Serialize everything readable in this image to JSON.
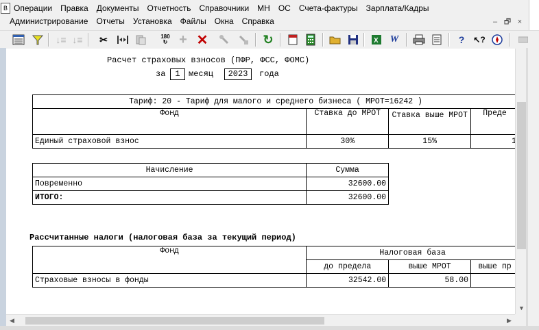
{
  "menu": {
    "row1": [
      "Операции",
      "Правка",
      "Документы",
      "Отчетность",
      "Справочники",
      "МН",
      "ОС",
      "Счета-фактуры",
      "Зарплата/Кадры"
    ],
    "row2": [
      "Администрирование",
      "Отчеты",
      "Установка",
      "Файлы",
      "Окна",
      "Справка"
    ]
  },
  "window_controls": [
    "–",
    "🗗",
    "×"
  ],
  "toolbar_icons": [
    "report-grid-icon",
    "filter-icon",
    "sort-asc-icon",
    "sort-desc-icon",
    "cut-icon",
    "split-icon",
    "delete-doc-icon",
    "rotate-180-icon",
    "add-icon",
    "delete-icon",
    "tool-icon",
    "tool2-icon",
    "refresh-icon",
    "calendar-icon",
    "calculator-icon",
    "open-folder-icon",
    "save-icon",
    "excel-icon",
    "word-icon",
    "print-icon",
    "page-icon",
    "help-icon",
    "context-help-icon",
    "compass-icon"
  ],
  "toolbar_glyphs": {
    "rotate": "180"
  },
  "report": {
    "title": "Расчет страховых взносов (ПФР, ФСС, ФОМС)",
    "za": "за",
    "month_value": "1",
    "month_label": "месяц",
    "year_value": "2023",
    "year_label": "года",
    "tariff_header": "Тариф: 20 - Тариф для малого и среднего бизнеса ( МРОТ=16242 )",
    "rates_table": {
      "headers": [
        "Фонд",
        "Ставка до МРОТ",
        "Ставка выше МРОТ",
        "Преде"
      ],
      "row": [
        "Единый страховой взнос",
        "30%",
        "15%",
        "1"
      ]
    },
    "accruals_table": {
      "headers": [
        "Начисление",
        "Сумма"
      ],
      "rows": [
        [
          "Повременно",
          "32600.00"
        ]
      ],
      "total_label": "ИТОГО:",
      "total_value": "32600.00"
    },
    "taxes_title": "Рассчитанные налоги (налоговая база за текущий период)",
    "taxes_table": {
      "header_fund": "Фонд",
      "header_base": "Налоговая база",
      "sub_headers": [
        "до предела",
        "выше МРОТ",
        "выше пр"
      ],
      "row": [
        "Страховые взносы в фонды",
        "32542.00",
        "58.00",
        ""
      ]
    }
  },
  "colors": {
    "background": "#f0f0f0",
    "document": "#ffffff",
    "accent": "#c9d3df"
  }
}
